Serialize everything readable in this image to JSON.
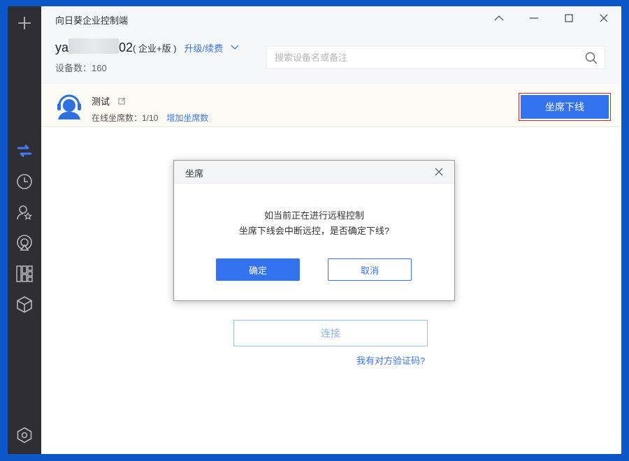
{
  "window": {
    "title": "向日葵企业控制端"
  },
  "account": {
    "name_prefix": "ya",
    "name_suffix": "02",
    "edition": "( 企业+版 )",
    "upgrade_link": "升级/续费",
    "device_count": "设备数：160"
  },
  "search": {
    "placeholder": "搜索设备名或备注"
  },
  "seat": {
    "name": "测试",
    "status": "在线坐席数：1/10",
    "add_link": "增加坐席数",
    "offline_button": "坐席下线"
  },
  "main": {
    "connect_button": "连接",
    "verify_link": "我有对方验证码?"
  },
  "dialog": {
    "title": "坐席",
    "message_line1": "如当前正在进行远程控制",
    "message_line2": "坐席下线会中断远控，是否确定下线?",
    "ok": "确定",
    "cancel": "取消"
  },
  "sidebar": {
    "items": [
      "add-icon",
      "remote-control-icon",
      "history-icon",
      "contacts-icon",
      "broadcast-icon",
      "apps-icon",
      "box-icon",
      "settings-icon"
    ]
  },
  "colors": {
    "accent": "#3373f0",
    "link": "#3d74e6",
    "sidebar": "#2f2f33",
    "highlight_border": "#d0272b"
  }
}
